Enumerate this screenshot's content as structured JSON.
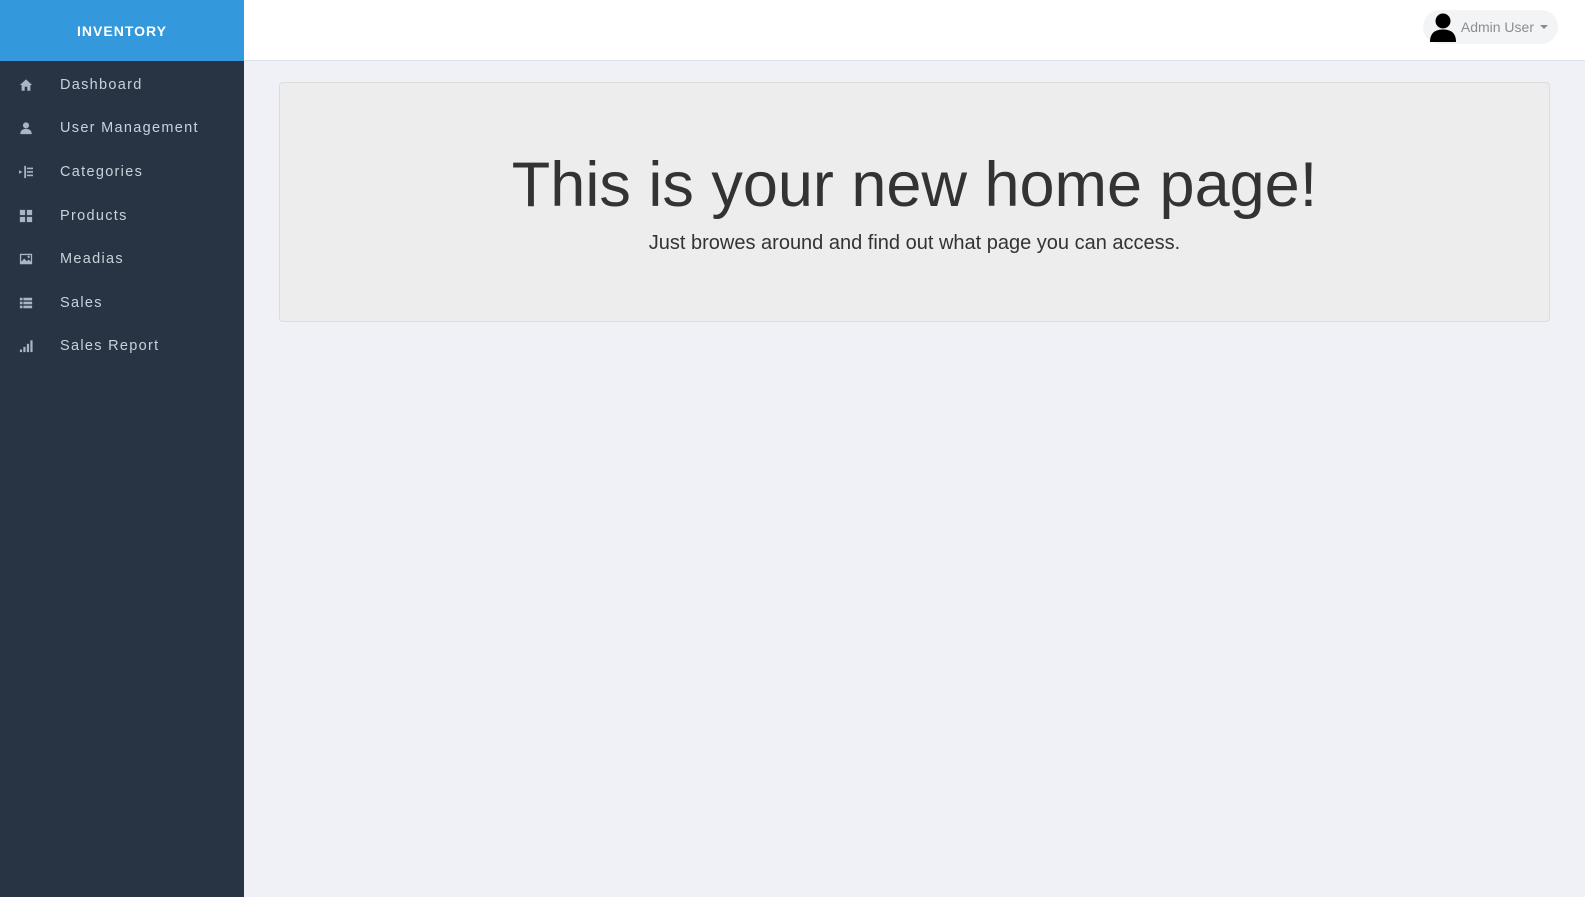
{
  "brand": {
    "title": "INVENTORY"
  },
  "sidebar": {
    "items": [
      {
        "label": "Dashboard",
        "icon": "home-icon"
      },
      {
        "label": "User Management",
        "icon": "user-icon"
      },
      {
        "label": "Categories",
        "icon": "indent-icon"
      },
      {
        "label": "Products",
        "icon": "grid-icon"
      },
      {
        "label": "Meadias",
        "icon": "picture-icon"
      },
      {
        "label": "Sales",
        "icon": "list-icon"
      },
      {
        "label": "Sales Report",
        "icon": "signal-icon"
      }
    ]
  },
  "header": {
    "user": {
      "name": "Admin User",
      "icon": "avatar-icon"
    }
  },
  "main": {
    "title": "This is your new home page!",
    "subtitle": "Just browes around and find out what page you can access."
  },
  "colors": {
    "brand": "#3399dc",
    "sidebar": "#283444",
    "background": "#eff1f6"
  }
}
